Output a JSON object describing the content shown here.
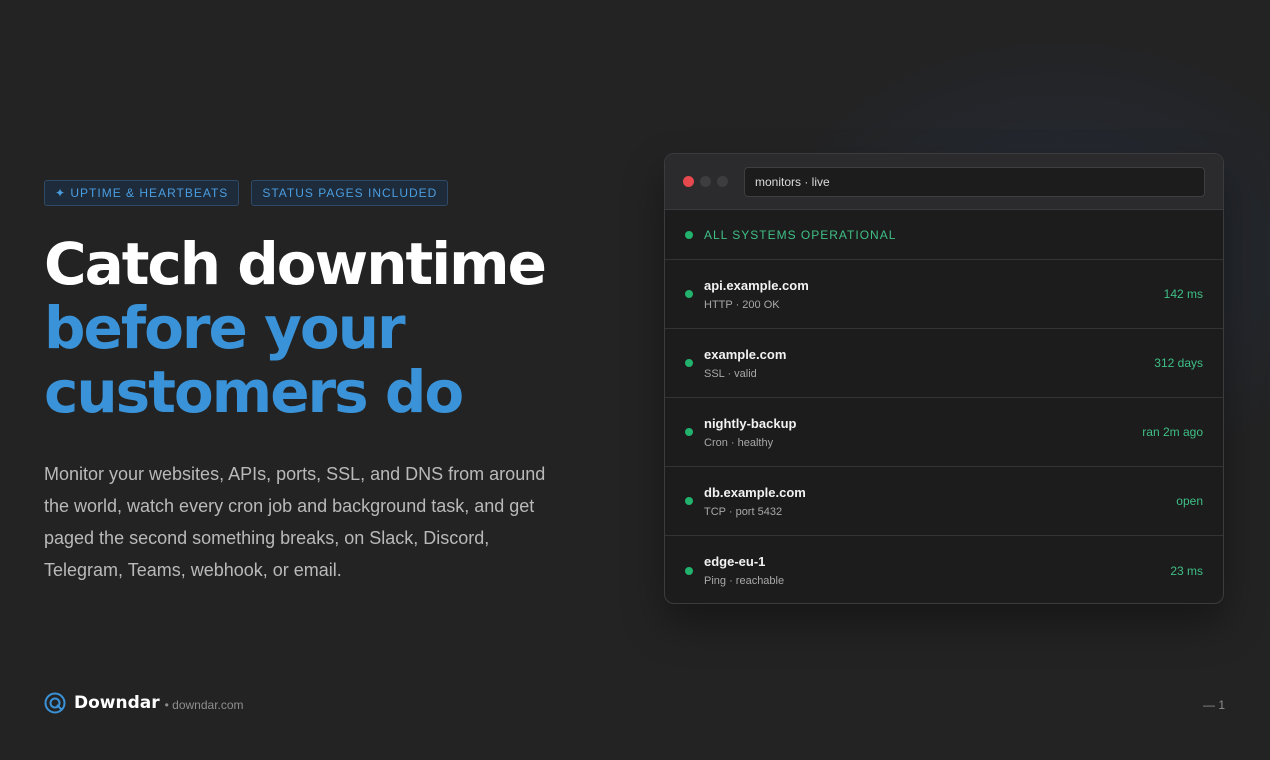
{
  "hero": {
    "pills": [
      "✦ UPTIME & HEARTBEATS",
      "STATUS PAGES INCLUDED"
    ],
    "headline_line1": "Catch downtime",
    "headline_line2": "before your",
    "headline_line3": "customers do",
    "description": "Monitor your websites, APIs, ports, SSL, and DNS from around the world, watch every cron job and background task, and get paged the second something breaks, on Slack, Discord, Telegram, Teams, webhook, or email."
  },
  "panel": {
    "address": "monitors · live",
    "status": "ALL SYSTEMS OPERATIONAL",
    "monitors": [
      {
        "name": "api.example.com",
        "detail": "HTTP · 200 OK",
        "value": "142 ms"
      },
      {
        "name": "example.com",
        "detail": "SSL · valid",
        "value": "312 days"
      },
      {
        "name": "nightly-backup",
        "detail": "Cron · healthy",
        "value": "ran 2m ago"
      },
      {
        "name": "db.example.com",
        "detail": "TCP · port 5432",
        "value": "open"
      },
      {
        "name": "edge-eu-1",
        "detail": "Ping · reachable",
        "value": "23 ms"
      }
    ]
  },
  "footer": {
    "brand": "Downdar",
    "domain": "• downdar.com",
    "page": "— 1"
  },
  "colors": {
    "accent": "#3a93d8",
    "ok": "#23b26d",
    "background": "#232324"
  },
  "icons": {
    "logo": "radar-icon"
  }
}
